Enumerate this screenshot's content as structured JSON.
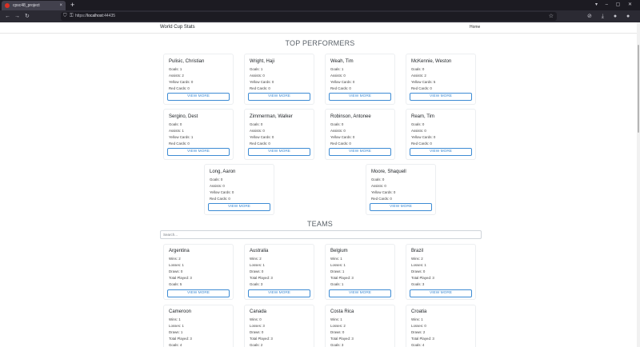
{
  "browser": {
    "tab_title": "cpsc48_project",
    "tab_close": "×",
    "new_tab": "+",
    "window_controls": "▾ – ▢ ✕",
    "url_prefix": "https://",
    "url_host": "localhost",
    "url_port": ":44435",
    "back": "←",
    "forward": "→",
    "reload": "↻",
    "shield": "⛉",
    "lock": "⚿",
    "star": "☆",
    "toolbar_right": "⊘ ⤓ ● ● ⧉ ≡"
  },
  "site": {
    "brand": "World Cup Stats",
    "home": "Home",
    "performers_title": "TOP PERFORMERS",
    "teams_title": "TEAMS",
    "search_placeholder": "Search...",
    "view_more": "VIEW MORE"
  },
  "players": [
    {
      "name": "Pulisic, Christian",
      "goals": "Goals: 1",
      "assists": "Assists: 2",
      "yellow": "Yellow Cards: 0",
      "red": "Red Cards: 0"
    },
    {
      "name": "Wright, Haji",
      "goals": "Goals: 1",
      "assists": "Assists: 0",
      "yellow": "Yellow Cards: 0",
      "red": "Red Cards: 0"
    },
    {
      "name": "Weah, Tim",
      "goals": "Goals: 1",
      "assists": "Assists: 0",
      "yellow": "Yellow Cards: 0",
      "red": "Red Cards: 0"
    },
    {
      "name": "McKennie, Weston",
      "goals": "Goals: 0",
      "assists": "Assists: 2",
      "yellow": "Yellow Cards: 5",
      "red": "Red Cards: 0"
    },
    {
      "name": "Sergino, Dest",
      "goals": "Goals: 0",
      "assists": "Assists: 1",
      "yellow": "Yellow Cards: 1",
      "red": "Red Cards: 0"
    },
    {
      "name": "Zimmerman, Walker",
      "goals": "Goals: 0",
      "assists": "Assists: 0",
      "yellow": "Yellow Cards: 0",
      "red": "Red Cards: 0"
    },
    {
      "name": "Robinson, Antonee",
      "goals": "Goals: 0",
      "assists": "Assists: 0",
      "yellow": "Yellow Cards: 0",
      "red": "Red Cards: 0"
    },
    {
      "name": "Ream, Tim",
      "goals": "Goals: 0",
      "assists": "Assists: 0",
      "yellow": "Yellow Cards: 0",
      "red": "Red Cards: 0"
    },
    {
      "name": "Long, Aaron",
      "goals": "Goals: 0",
      "assists": "Assists: 0",
      "yellow": "Yellow Cards: 0",
      "red": "Red Cards: 0"
    },
    {
      "name": "Moore, Shaquell",
      "goals": "Goals: 0",
      "assists": "Assists: 0",
      "yellow": "Yellow Cards: 0",
      "red": "Red Cards: 0"
    }
  ],
  "teams": [
    {
      "name": "Argentina",
      "wins": "Wins: 2",
      "losses": "Losses: 1",
      "draws": "Draws: 0",
      "played": "Total Played: 3",
      "goals": "Goals: 5"
    },
    {
      "name": "Australia",
      "wins": "Wins: 2",
      "losses": "Losses: 1",
      "draws": "Draws: 0",
      "played": "Total Played: 3",
      "goals": "Goals: 3"
    },
    {
      "name": "Belgium",
      "wins": "Wins: 1",
      "losses": "Losses: 1",
      "draws": "Draws: 1",
      "played": "Total Played: 3",
      "goals": "Goals: 1"
    },
    {
      "name": "Brazil",
      "wins": "Wins: 2",
      "losses": "Losses: 1",
      "draws": "Draws: 0",
      "played": "Total Played: 3",
      "goals": "Goals: 3"
    },
    {
      "name": "Cameroon",
      "wins": "Wins: 1",
      "losses": "Losses: 1",
      "draws": "Draws: 1",
      "played": "Total Played: 3",
      "goals": "Goals: 4"
    },
    {
      "name": "Canada",
      "wins": "Wins: 0",
      "losses": "Losses: 3",
      "draws": "Draws: 0",
      "played": "Total Played: 3",
      "goals": "Goals: 2"
    },
    {
      "name": "Costa Rica",
      "wins": "Wins: 1",
      "losses": "Losses: 2",
      "draws": "Draws: 0",
      "played": "Total Played: 3",
      "goals": "Goals: 3"
    },
    {
      "name": "Croatia",
      "wins": "Wins: 1",
      "losses": "Losses: 0",
      "draws": "Draws: 2",
      "played": "Total Played: 3",
      "goals": "Goals: 4"
    }
  ]
}
